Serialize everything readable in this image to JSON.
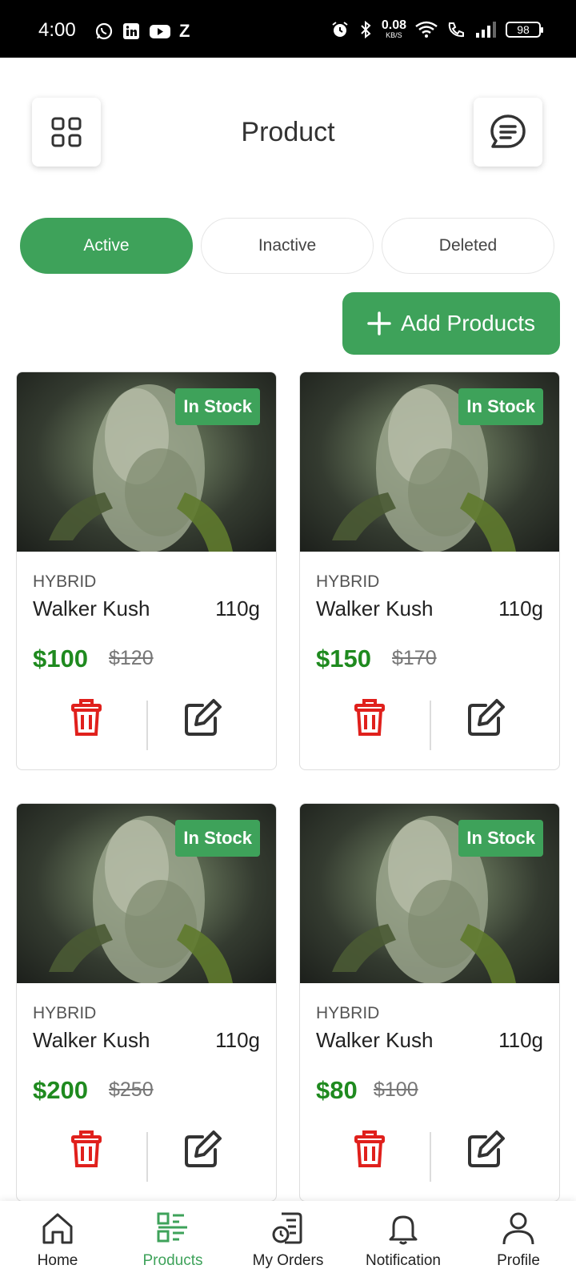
{
  "status_bar": {
    "time": "4:00",
    "left_icons": [
      "whatsapp-icon",
      "linkedin-icon",
      "youtube-icon",
      "z-icon"
    ],
    "z_label": "Z",
    "net_speed": "0.08",
    "net_unit": "KB/S",
    "battery": "98"
  },
  "header": {
    "title": "Product",
    "left_icon": "grid-icon",
    "right_icon": "chat-icon"
  },
  "tabs": [
    {
      "label": "Active",
      "active": true
    },
    {
      "label": "Inactive",
      "active": false
    },
    {
      "label": "Deleted",
      "active": false
    }
  ],
  "add_button": {
    "label": "Add Products",
    "icon": "plus-icon"
  },
  "products": [
    {
      "badge": "In Stock",
      "category": "HYBRID",
      "name": "Walker Kush",
      "weight": "110g",
      "price": "$100",
      "old_price": "$120"
    },
    {
      "badge": "In Stock",
      "category": "HYBRID",
      "name": "Walker Kush",
      "weight": "110g",
      "price": "$150",
      "old_price": "$170"
    },
    {
      "badge": "In Stock",
      "category": "HYBRID",
      "name": "Walker Kush",
      "weight": "110g",
      "price": "$200",
      "old_price": "$250"
    },
    {
      "badge": "In Stock",
      "category": "HYBRID",
      "name": "Walker Kush",
      "weight": "110g",
      "price": "$80",
      "old_price": "$100"
    }
  ],
  "bottom_nav": [
    {
      "label": "Home",
      "icon": "home-icon",
      "active": false
    },
    {
      "label": "Products",
      "icon": "products-icon",
      "active": true
    },
    {
      "label": "My Orders",
      "icon": "orders-icon",
      "active": false
    },
    {
      "label": "Notification",
      "icon": "bell-icon",
      "active": false
    },
    {
      "label": "Profile",
      "icon": "profile-icon",
      "active": false
    }
  ],
  "colors": {
    "accent": "#3ea25a",
    "price": "#1f8a1f",
    "delete": "#e0201c",
    "edit": "#333333"
  }
}
